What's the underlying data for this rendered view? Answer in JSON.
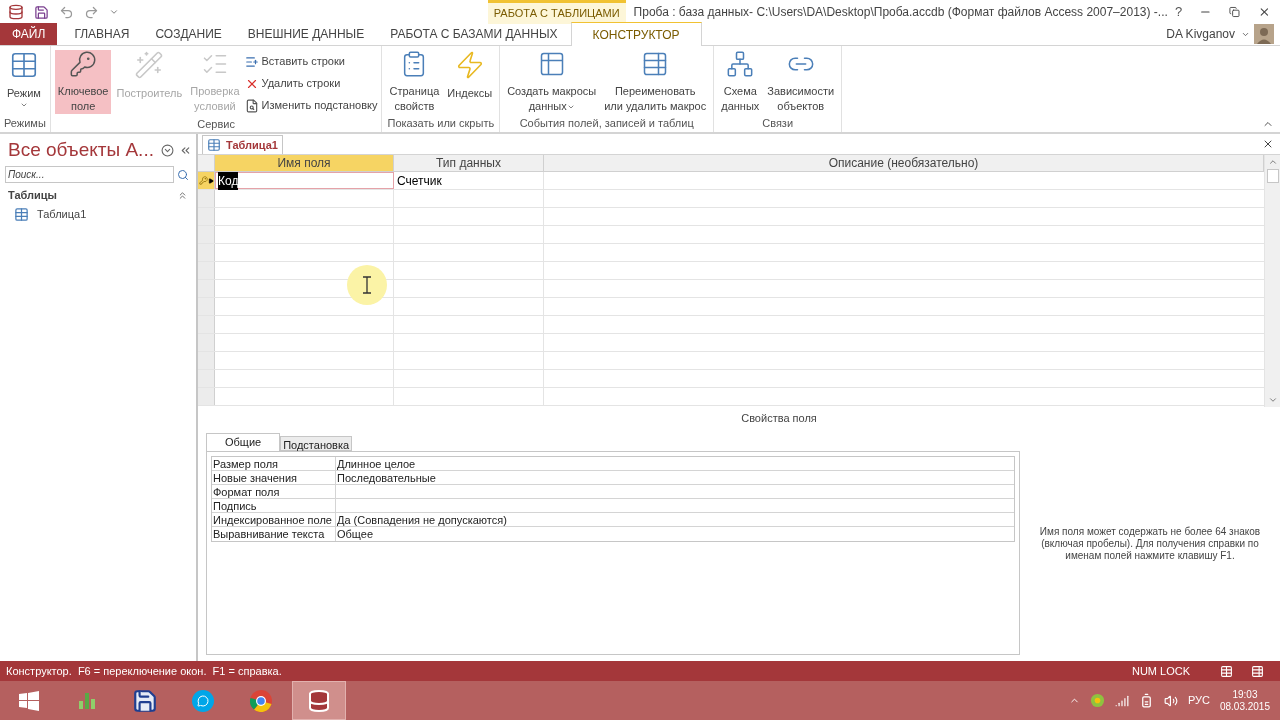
{
  "title_bar": {
    "context_tab": "РАБОТА С ТАБЛИЦАМИ",
    "title": "Проба : база данных- C:\\Users\\DA\\Desktop\\Проба.accdb (Формат файлов Access 2007–2013) -...",
    "help": "?"
  },
  "menu_tabs": [
    {
      "label": "ФАЙЛ",
      "kind": "file",
      "selected": false
    },
    {
      "label": "ГЛАВНАЯ",
      "kind": "tab",
      "selected": false
    },
    {
      "label": "СОЗДАНИЕ",
      "kind": "tab",
      "selected": false
    },
    {
      "label": "ВНЕШНИЕ ДАННЫЕ",
      "kind": "tab",
      "selected": false
    },
    {
      "label": "РАБОТА С БАЗАМИ ДАННЫХ",
      "kind": "tab",
      "selected": false
    },
    {
      "label": "КОНСТРУКТОР",
      "kind": "tab",
      "selected": true
    }
  ],
  "user": {
    "name": "DA Kivganov"
  },
  "ribbon": [
    {
      "label": "Режимы",
      "items": [
        {
          "kind": "large",
          "lines": [
            "Режим"
          ],
          "dropdown": true,
          "disabled": false,
          "selected": false
        }
      ]
    },
    {
      "label": "Сервис",
      "items": [
        {
          "kind": "large",
          "lines": [
            "Ключевое",
            "поле"
          ],
          "dropdown": false,
          "disabled": false,
          "selected": true
        },
        {
          "kind": "large",
          "lines": [
            "Построитель"
          ],
          "dropdown": false,
          "disabled": true,
          "selected": false
        },
        {
          "kind": "large",
          "lines": [
            "Проверка",
            "условий"
          ],
          "dropdown": false,
          "disabled": true,
          "selected": false
        },
        {
          "kind": "small",
          "entries": [
            "Вставить строки",
            "Удалить строки",
            "Изменить подстановку"
          ]
        }
      ]
    },
    {
      "label": "Показать или скрыть",
      "items": [
        {
          "kind": "large",
          "lines": [
            "Страница",
            "свойств"
          ],
          "dropdown": false,
          "disabled": false,
          "selected": false
        },
        {
          "kind": "large",
          "lines": [
            "Индексы"
          ],
          "dropdown": false,
          "disabled": false,
          "selected": false
        }
      ]
    },
    {
      "label": "События полей, записей и таблиц",
      "items": [
        {
          "kind": "large",
          "lines": [
            "Создать макросы",
            "данных"
          ],
          "dropdown": true,
          "disabled": false,
          "selected": false
        },
        {
          "kind": "large",
          "lines": [
            "Переименовать",
            "или удалить макрос"
          ],
          "dropdown": false,
          "disabled": false,
          "selected": false
        }
      ]
    },
    {
      "label": "Связи",
      "items": [
        {
          "kind": "large",
          "lines": [
            "Схема",
            "данных"
          ],
          "dropdown": false,
          "disabled": false,
          "selected": false
        },
        {
          "kind": "large",
          "lines": [
            "Зависимости",
            "объектов"
          ],
          "dropdown": false,
          "disabled": false,
          "selected": false
        }
      ]
    }
  ],
  "nav_pane": {
    "title": "Все объекты А...",
    "search": {
      "placeholder": "Поиск..."
    },
    "groups": [
      {
        "label": "Таблицы",
        "expanded": true,
        "items": [
          {
            "label": "Таблица1",
            "selected": false
          }
        ]
      }
    ]
  },
  "doc_tabs": [
    {
      "label": "Таблица1",
      "selected": true
    }
  ],
  "design_grid": {
    "columns": [
      "Имя поля",
      "Тип данных",
      "Описание (необязательно)"
    ],
    "rows": [
      {
        "name": "Код",
        "type": "Счетчик",
        "primary_key": true,
        "selected": true
      }
    ]
  },
  "field_properties": {
    "caption": "Свойства поля",
    "tabs": [
      {
        "label": "Общие",
        "selected": true
      },
      {
        "label": "Подстановка",
        "selected": false
      }
    ],
    "rows": [
      {
        "label": "Размер поля",
        "value": "Длинное целое"
      },
      {
        "label": "Новые значения",
        "value": "Последовательные"
      },
      {
        "label": "Формат поля",
        "value": ""
      },
      {
        "label": "Подпись",
        "value": ""
      },
      {
        "label": "Индексированное поле",
        "value": "Да (Совпадения не допускаются)"
      },
      {
        "label": "Выравнивание текста",
        "value": "Общее"
      }
    ],
    "help": "Имя поля может содержать не более 64 знаков (включая пробелы). Для получения справки по именам полей нажмите клавишу F1."
  },
  "status_bar": {
    "text": "Конструктор.  F6 = переключение окон.  F1 = справка.",
    "num_lock": "NUM LOCK"
  },
  "taskbar": {
    "apps": [
      {
        "selected": false
      },
      {
        "selected": false
      },
      {
        "selected": false
      },
      {
        "selected": false
      },
      {
        "selected": false
      },
      {
        "selected": true
      }
    ],
    "language": "РУС",
    "time": "19:03",
    "date": "08.03.2015"
  }
}
